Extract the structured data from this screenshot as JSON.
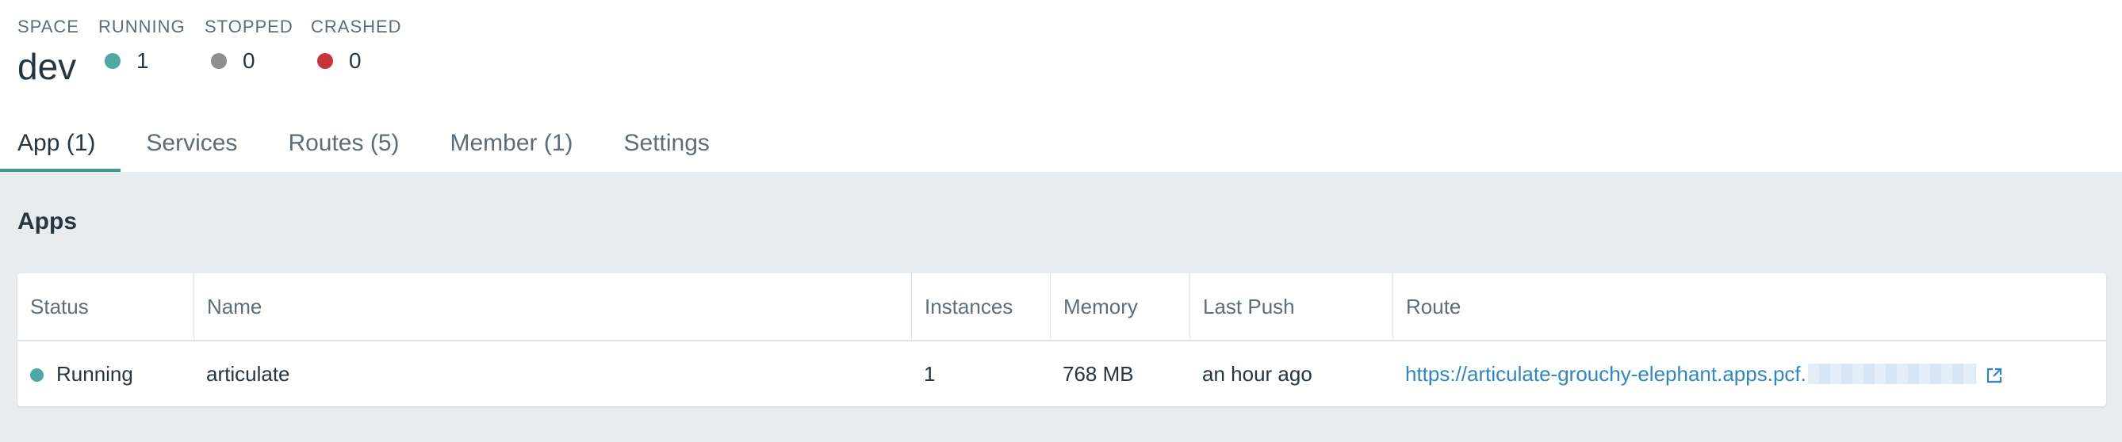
{
  "space": {
    "label": "SPACE",
    "name": "dev"
  },
  "counts": {
    "running": {
      "label": "RUNNING",
      "value": "1"
    },
    "stopped": {
      "label": "STOPPED",
      "value": "0"
    },
    "crashed": {
      "label": "CRASHED",
      "value": "0"
    }
  },
  "tabs": [
    {
      "label": "App (1)",
      "active": true
    },
    {
      "label": "Services",
      "active": false
    },
    {
      "label": "Routes (5)",
      "active": false
    },
    {
      "label": "Member (1)",
      "active": false
    },
    {
      "label": "Settings",
      "active": false
    }
  ],
  "apps_section": {
    "title": "Apps",
    "columns": [
      "Status",
      "Name",
      "Instances",
      "Memory",
      "Last Push",
      "Route"
    ],
    "rows": [
      {
        "status": "Running",
        "name": "articulate",
        "instances": "1",
        "memory": "768 MB",
        "last_push": "an hour ago",
        "route": "https://articulate-grouchy-elephant.apps.pcf."
      }
    ]
  },
  "colors": {
    "running": "#4ea8a3",
    "stopped": "#8e8e8e",
    "crashed": "#c8343b",
    "tab_accent": "#3e9b8e",
    "link": "#2f86c4"
  },
  "icons": {
    "external_link": "external-link-icon"
  }
}
